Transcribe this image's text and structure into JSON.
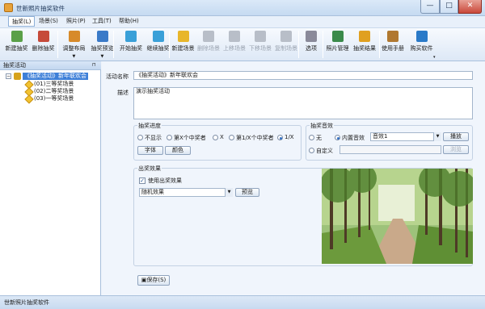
{
  "window": {
    "title": "世新照片抽奖软件",
    "controls": {
      "minimize": "—",
      "maximize": "□",
      "close": "✕"
    }
  },
  "menu": [
    "抽奖(L)",
    "场景(S)",
    "照片(P)",
    "工具(T)",
    "帮助(H)"
  ],
  "toolbar": {
    "buttons": [
      {
        "label": "新建抽奖",
        "icon": "new-draw-icon",
        "color": "#5aa048",
        "enabled": true
      },
      {
        "label": "删除抽奖",
        "icon": "delete-draw-icon",
        "color": "#c64a3a",
        "enabled": true
      },
      {
        "label": "调整布局",
        "icon": "layout-icon",
        "color": "#d78a2a",
        "enabled": true
      },
      {
        "label": "抽奖预览",
        "icon": "preview-search-icon",
        "color": "#3a7ac8",
        "enabled": true
      },
      {
        "label": "开始抽奖",
        "icon": "play-icon",
        "color": "#3aa0d8",
        "enabled": true
      },
      {
        "label": "继续抽奖",
        "icon": "continue-icon",
        "color": "#3aa0d8",
        "enabled": true
      },
      {
        "label": "新建场景",
        "icon": "new-scene-icon",
        "color": "#e8b62a",
        "enabled": true
      },
      {
        "label": "删除场景",
        "icon": "delete-scene-icon",
        "color": "#b8bec8",
        "enabled": false
      },
      {
        "label": "上移场景",
        "icon": "move-up-icon",
        "color": "#b8bec8",
        "enabled": false
      },
      {
        "label": "下移场景",
        "icon": "move-down-icon",
        "color": "#b8bec8",
        "enabled": false
      },
      {
        "label": "复制场景",
        "icon": "copy-scene-icon",
        "color": "#b8bec8",
        "enabled": false
      },
      {
        "label": "选项",
        "icon": "wrench-icon",
        "color": "#8a8a9a",
        "enabled": true
      },
      {
        "label": "照片管理",
        "icon": "people-icon",
        "color": "#3a8a4a",
        "enabled": true
      },
      {
        "label": "抽奖结果",
        "icon": "medal-icon",
        "color": "#e0a020",
        "enabled": true
      },
      {
        "label": "使用手册",
        "icon": "manual-icon",
        "color": "#b07830",
        "enabled": true
      },
      {
        "label": "购买软件",
        "icon": "cart-icon",
        "color": "#2a7ac8",
        "enabled": true
      }
    ],
    "grip": "▾"
  },
  "left_pane": {
    "title": "抽奖活动",
    "pin": "⊓",
    "tree": {
      "root": "《抽奖活动》新年联欢会",
      "children": [
        "(01)三等奖场景",
        "(02)二等奖场景",
        "(03)一等奖场景"
      ]
    }
  },
  "form": {
    "name_label": "活动名称",
    "name_value": "《抽奖活动》新年联欢会",
    "desc_label": "描述",
    "desc_value": "演示抽奖活动"
  },
  "progress_group": {
    "title": "抽奖进度",
    "options": [
      "不显示",
      "第X个中奖者",
      "X",
      "第1/X个中奖者",
      "1/X"
    ],
    "selected": 4,
    "font_button": "字体",
    "color_button": "颜色"
  },
  "sound_group": {
    "title": "抽奖音效",
    "none_label": "无",
    "builtin_label": "内置音效",
    "builtin_value": "音效1",
    "play_button": "播放",
    "custom_label": "自定义",
    "browse_button": "浏览",
    "selected": 1
  },
  "effect_group": {
    "title": "出奖效果",
    "use_effect_label": "使用出奖效果",
    "use_effect_checked": true,
    "effect_value": "随机效果",
    "preview_button": "预览"
  },
  "save_button": "保存(S)",
  "statusbar": {
    "text": "世新照片抽奖软件"
  }
}
